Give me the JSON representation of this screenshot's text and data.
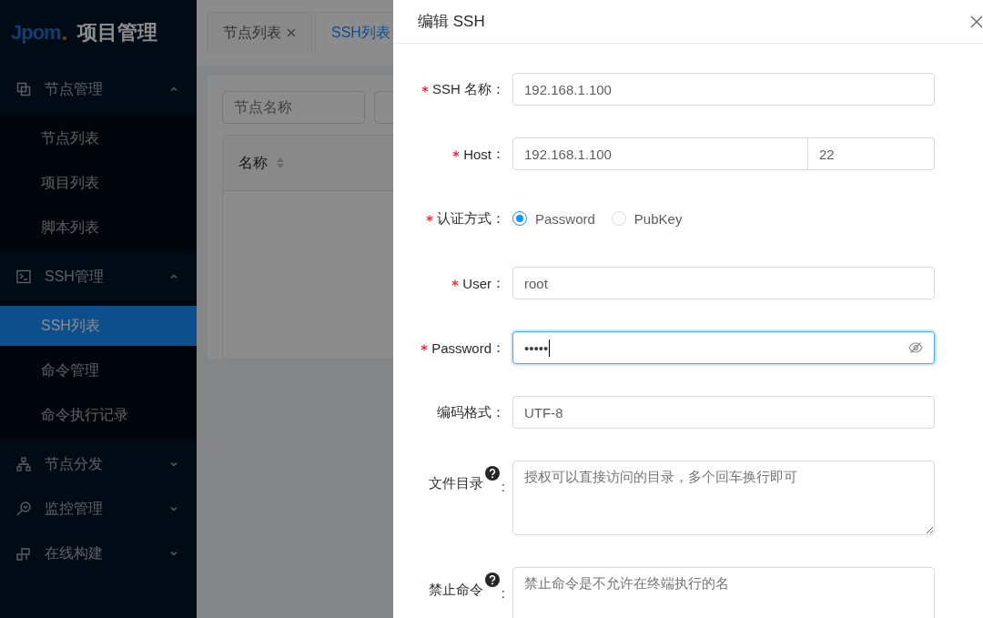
{
  "sidebar": {
    "logo_text": "Jpom",
    "title": "项目管理",
    "menu": [
      {
        "label": "节点管理",
        "expanded": true,
        "children": [
          {
            "label": "节点列表",
            "selected": false
          },
          {
            "label": "项目列表",
            "selected": false
          },
          {
            "label": "脚本列表",
            "selected": false
          }
        ]
      },
      {
        "label": "SSH管理",
        "expanded": true,
        "children": [
          {
            "label": "SSH列表",
            "selected": true
          },
          {
            "label": "命令管理",
            "selected": false
          },
          {
            "label": "命令执行记录",
            "selected": false
          }
        ]
      },
      {
        "label": "节点分发",
        "expanded": false
      },
      {
        "label": "监控管理",
        "expanded": false
      },
      {
        "label": "在线构建",
        "expanded": false
      }
    ]
  },
  "main": {
    "tabs": [
      {
        "label": "节点列表",
        "closable": true,
        "selected": false
      },
      {
        "label": "SSH列表",
        "closable": false,
        "selected": true
      }
    ],
    "filters": [
      {
        "kind": "input",
        "placeholder": "节点名称"
      },
      {
        "kind": "input"
      }
    ],
    "table": {
      "columns": [
        {
          "label": "名称",
          "sortable": true
        }
      ]
    }
  },
  "drawer": {
    "title": "编辑 SSH",
    "fields": [
      {
        "kind": "input",
        "label": "SSH 名称",
        "colon": "：",
        "required": true,
        "value": "192.168.1.100"
      },
      {
        "kind": "host",
        "label": "Host",
        "colon": "：",
        "required": true,
        "value": "192.168.1.100",
        "port": "22"
      },
      {
        "kind": "radio",
        "label": "认证方式",
        "colon": "：",
        "required": true,
        "options": [
          {
            "label": "Password",
            "selected": true
          },
          {
            "label": "PubKey",
            "selected": false
          }
        ]
      },
      {
        "kind": "input",
        "label": "User",
        "colon": "：",
        "required": true,
        "value": "root"
      },
      {
        "kind": "password",
        "label": "Password",
        "colon": "：",
        "required": true,
        "value": "•••••",
        "focused": true
      },
      {
        "kind": "input",
        "label": "编码格式",
        "colon": "：",
        "required": false,
        "value": "UTF-8"
      },
      {
        "kind": "textarea",
        "label": "文件目录",
        "colon": ":",
        "required": false,
        "help": true,
        "placeholder": "授权可以直接访问的目录，多个回车换行即可"
      },
      {
        "kind": "textarea",
        "label": "禁止命令",
        "colon": ":",
        "required": false,
        "help": true,
        "placeholder": "禁止命令是不允许在终端执行的名"
      }
    ]
  }
}
